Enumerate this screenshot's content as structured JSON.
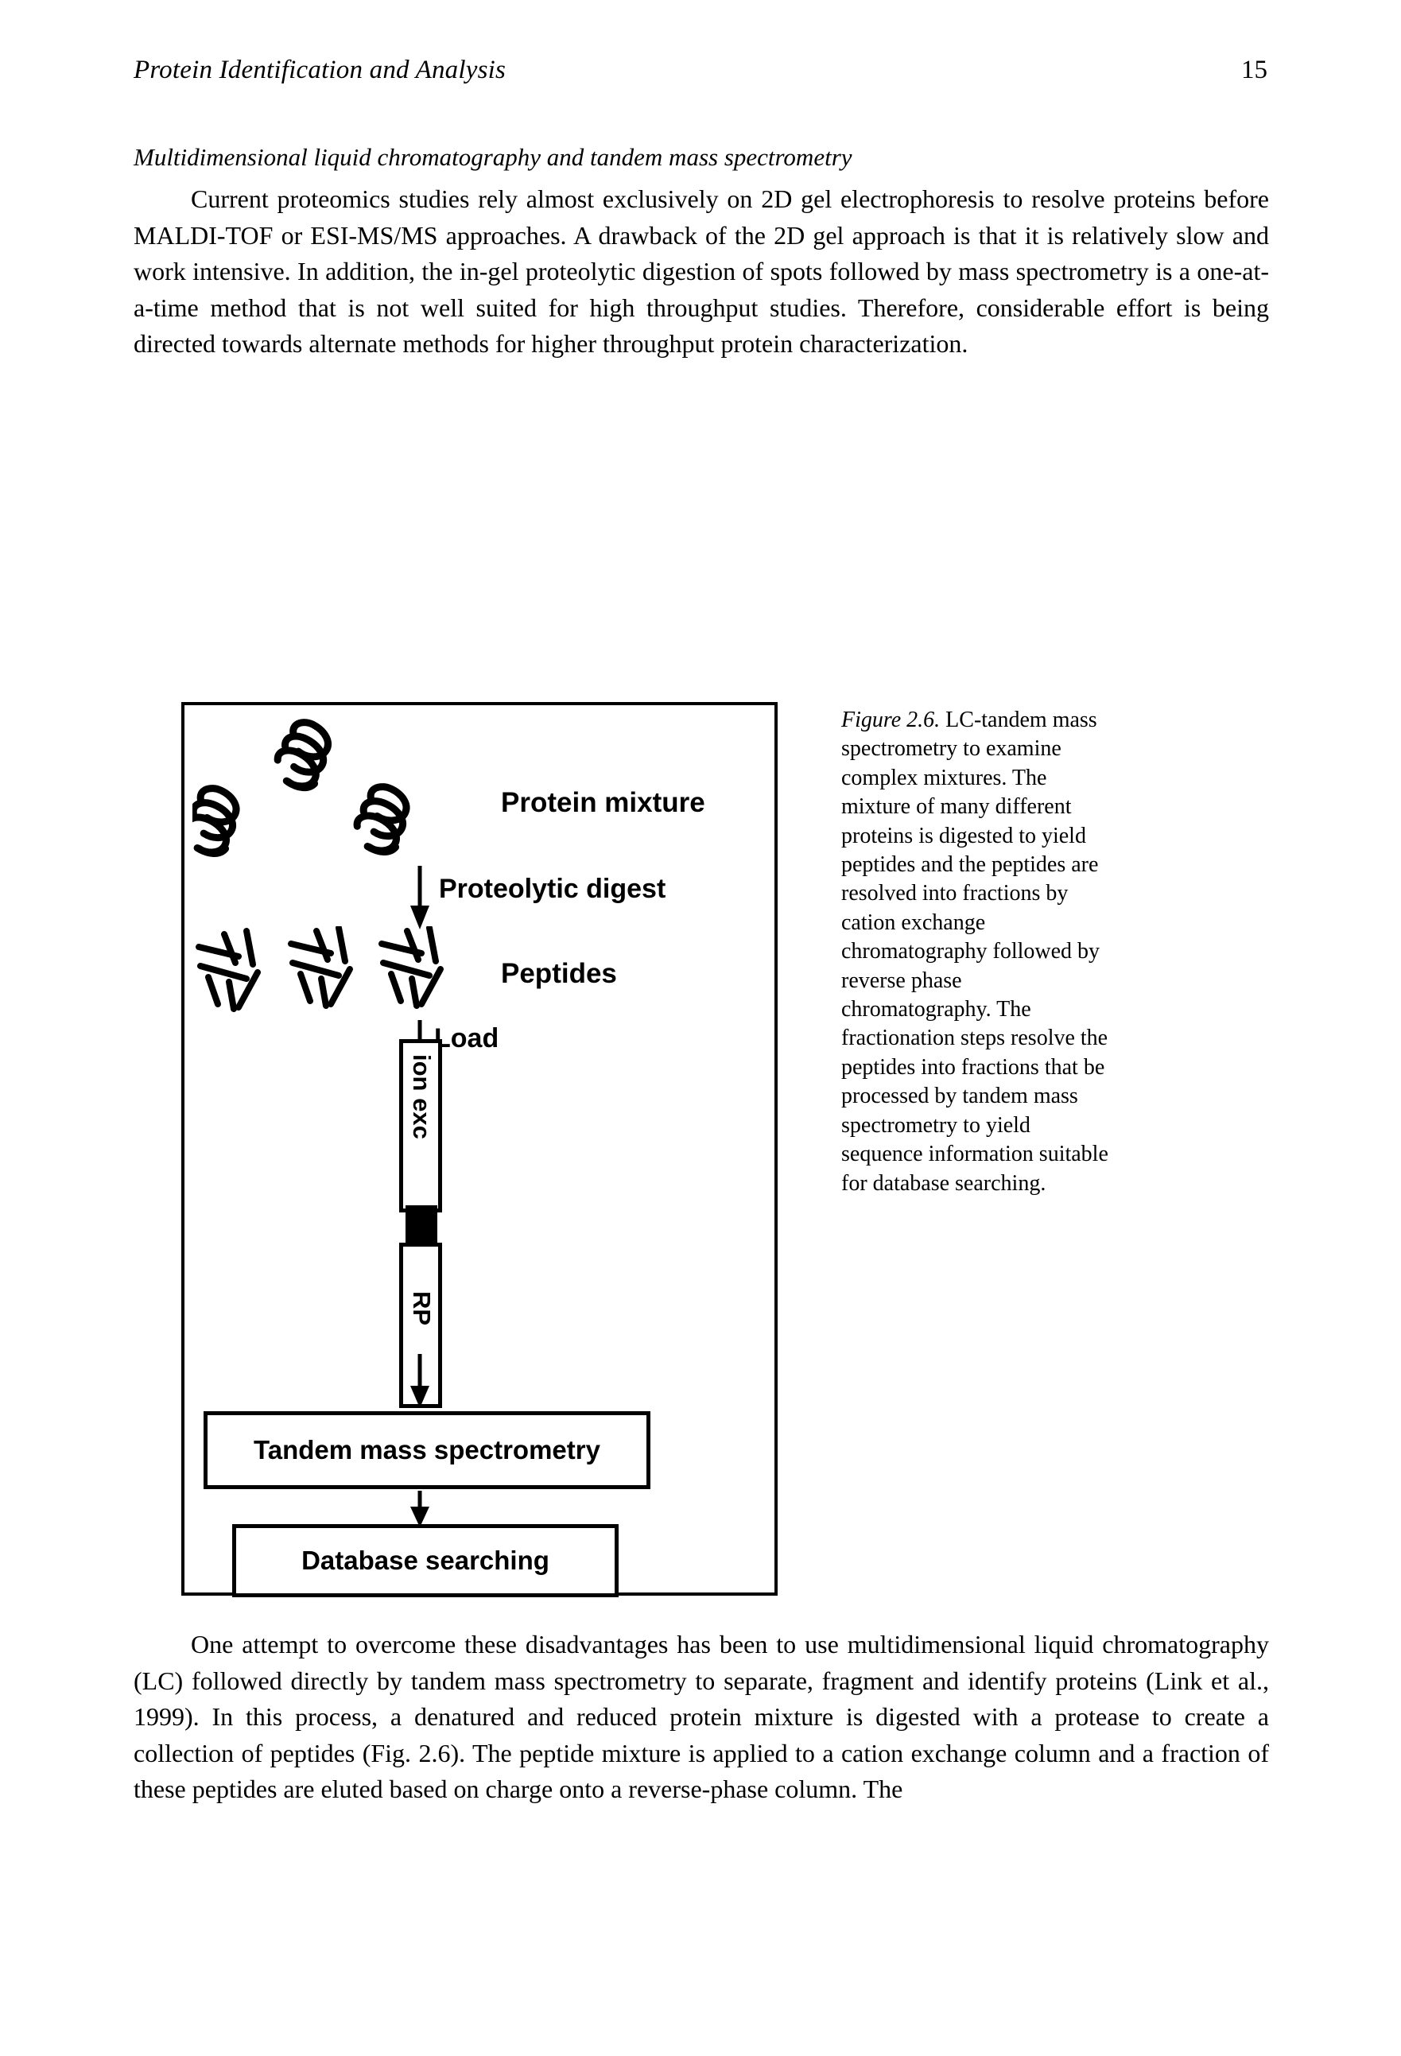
{
  "page": {
    "number": "15",
    "running_head": "Protein Identification and Analysis"
  },
  "section": {
    "subhead": "Multidimensional liquid chromatography and tandem mass spectrometry"
  },
  "paragraphs": {
    "intro": "Current proteomics studies rely almost exclusively on 2D gel electrophoresis to resolve proteins before MALDI-TOF or ESI-MS/MS approaches. A drawback of the 2D gel approach is that it is relatively slow and work intensive. In addition, the in-gel proteolytic digestion of spots followed by mass spectrometry is a one-at-a-time method that is not well suited for high throughput studies. Therefore, considerable effort is being directed towards alternate methods for higher throughput protein characterization.",
    "closing": "One attempt to overcome these disadvantages has been to use multidimensional liquid chromatography (LC) followed directly by tandem mass spectrometry to separate, fragment and identify proteins (Link et al., 1999). In this process, a denatured and reduced protein mixture is digested with a protease to create a collection of peptides (Fig. 2.6). The peptide mixture is applied to a cation exchange column and a fraction of these peptides are eluted based on charge onto a reverse-phase column. The"
  },
  "figure": {
    "caption_lead": "Figure 2.6.",
    "caption_body": " LC-tandem mass spectrometry to examine complex mixtures. The mixture of many different proteins is digested to yield peptides and the peptides are resolved into fractions by cation exchange chromatography followed by reverse phase chromatography. The fractionation steps resolve the peptides into fractions that be processed by tandem mass spectrometry to yield sequence information suitable for database searching.",
    "diagram": {
      "protein_label": "Protein mixture",
      "step_digest": "Proteolytic digest",
      "peptides_label": "Peptides",
      "step_load": "Load",
      "column_ion_exchange": "ion exc",
      "column_reverse_phase": "RP",
      "box_tandem": "Tandem mass spectrometry",
      "box_database": "Database searching"
    }
  },
  "colors": {
    "ink": "#000000",
    "paper": "#ffffff"
  }
}
